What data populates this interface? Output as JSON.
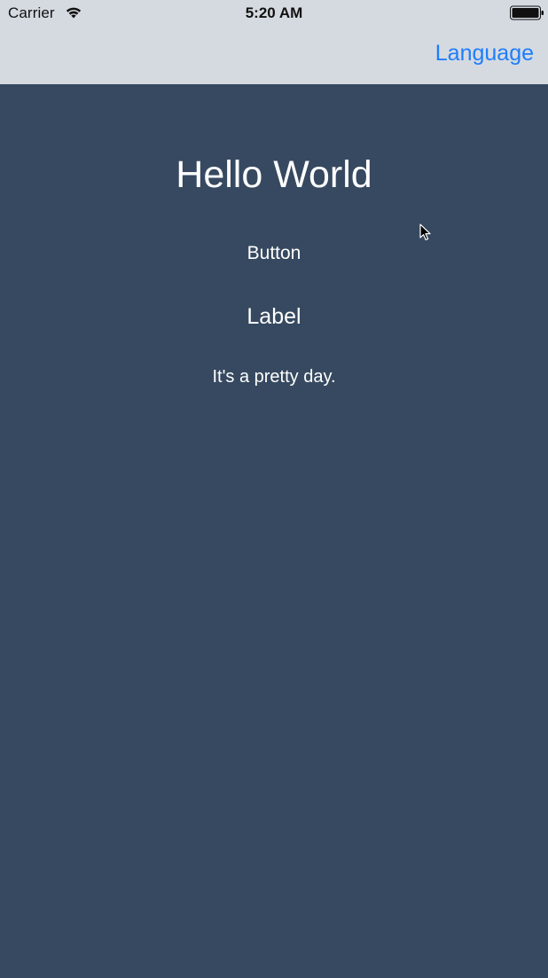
{
  "status_bar": {
    "carrier": "Carrier",
    "time": "5:20 AM",
    "icons": [
      "wifi-icon",
      "battery-icon"
    ]
  },
  "nav_bar": {
    "right_button": "Language"
  },
  "main": {
    "title": "Hello World",
    "button_label": "Button",
    "label_text": "Label",
    "subtitle": "It's a pretty day."
  },
  "colors": {
    "nav_background": "#d5dae1",
    "content_background": "#364960",
    "accent": "#1f7dfa",
    "text": "#ffffff"
  }
}
